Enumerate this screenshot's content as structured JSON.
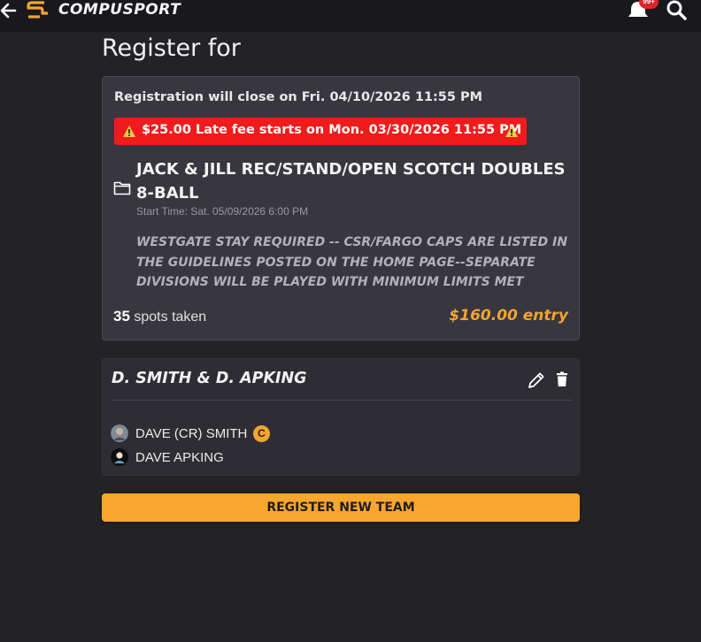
{
  "app": {
    "brand": "COMPUSPORT",
    "notification_count": "99+",
    "icons": {
      "back": "back-arrow-icon",
      "logo": "compusport-logo-icon",
      "bell": "bell-icon",
      "search": "search-icon"
    }
  },
  "page": {
    "title": "Register for"
  },
  "event": {
    "close_notice": "Registration will close on Fri. 04/10/2026 11:55 PM",
    "late_fee_notice": "$25.00 Late fee starts on Mon. 03/30/2026 11:55 PM",
    "name": "JACK & JILL REC/STAND/OPEN SCOTCH DOUBLES 8-BALL",
    "start_time": "Start Time: Sat. 05/09/2026 6:00 PM",
    "notes": "WESTGATE STAY REQUIRED -- CSR/FARGO CAPS ARE LISTED IN THE GUIDELINES POSTED ON THE HOME PAGE--SEPARATE DIVISIONS WILL BE PLAYED WITH MINIMUM LIMITS MET",
    "spots_taken_count": "35",
    "spots_taken_label": "spots taken",
    "entry_fee": "$160.00 entry"
  },
  "team": {
    "name": "D. SMITH & D. APKING",
    "members": [
      {
        "name": "DAVE (CR) SMITH",
        "badge": "C"
      },
      {
        "name": "DAVE APKING"
      }
    ]
  },
  "actions": {
    "register_new_team": "REGISTER NEW TEAM"
  },
  "colors": {
    "accent": "#f8a630",
    "warning": "#f11b1b",
    "background": "#232227",
    "card": "#38363e"
  }
}
